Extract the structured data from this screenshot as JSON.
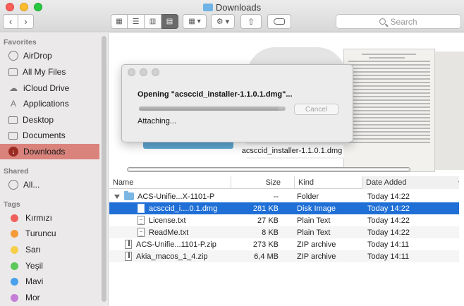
{
  "window": {
    "title": "Downloads"
  },
  "toolbar": {
    "back_icon": "chevron-left-icon",
    "forward_icon": "chevron-right-icon",
    "view_icons": [
      "icon-view-icon",
      "list-view-icon",
      "column-view-icon",
      "cover-flow-view-icon"
    ],
    "active_view": "cover-flow",
    "search_placeholder": "Search"
  },
  "sidebar": {
    "favorites_label": "Favorites",
    "favorites": [
      {
        "label": "AirDrop",
        "icon": "airdrop-icon"
      },
      {
        "label": "All My Files",
        "icon": "all-files-icon"
      },
      {
        "label": "iCloud Drive",
        "icon": "cloud-icon"
      },
      {
        "label": "Applications",
        "icon": "applications-icon"
      },
      {
        "label": "Desktop",
        "icon": "desktop-icon"
      },
      {
        "label": "Documents",
        "icon": "documents-icon"
      },
      {
        "label": "Downloads",
        "icon": "downloads-icon",
        "selected": true
      }
    ],
    "shared_label": "Shared",
    "shared": [
      {
        "label": "All...",
        "icon": "network-icon"
      }
    ],
    "tags_label": "Tags",
    "tags": [
      {
        "label": "Kırmızı",
        "color": "#f0615b"
      },
      {
        "label": "Turuncu",
        "color": "#f59a3a"
      },
      {
        "label": "Sarı",
        "color": "#f5cf4a"
      },
      {
        "label": "Yeşil",
        "color": "#5bc85a"
      },
      {
        "label": "Mavi",
        "color": "#4aa0ea"
      },
      {
        "label": "Mor",
        "color": "#c47ed8"
      }
    ]
  },
  "preview": {
    "selected_file_name": "acsccid_installer-1.1.0.1.dmg"
  },
  "dialog": {
    "title": "Opening \"acsccid_installer-1.1.0.1.dmg\"...",
    "status": "Attaching...",
    "cancel_label": "Cancel",
    "progress": 0.95
  },
  "list": {
    "columns": {
      "name": "Name",
      "size": "Size",
      "kind": "Kind",
      "date": "Date Added"
    },
    "rows": [
      {
        "name": "ACS-Unifie...X-1101-P",
        "size": "--",
        "kind": "Folder",
        "date": "Today 14:22",
        "type": "folder",
        "expanded": true,
        "indent": 0
      },
      {
        "name": "acsccid_i....0.1.dmg",
        "size": "281 KB",
        "kind": "Disk Image",
        "date": "Today 14:22",
        "type": "dmg",
        "indent": 1,
        "selected": true
      },
      {
        "name": "License.txt",
        "size": "27 KB",
        "kind": "Plain Text",
        "date": "Today 14:22",
        "type": "doc",
        "indent": 1
      },
      {
        "name": "ReadMe.txt",
        "size": "8 KB",
        "kind": "Plain Text",
        "date": "Today 14:22",
        "type": "doc",
        "indent": 1
      },
      {
        "name": "ACS-Unifie...1101-P.zip",
        "size": "273 KB",
        "kind": "ZIP archive",
        "date": "Today 14:11",
        "type": "zip",
        "indent": 0
      },
      {
        "name": "Akia_macos_1_4.zip",
        "size": "6,4 MB",
        "kind": "ZIP archive",
        "date": "Today 14:11",
        "type": "zip",
        "indent": 0
      }
    ]
  }
}
